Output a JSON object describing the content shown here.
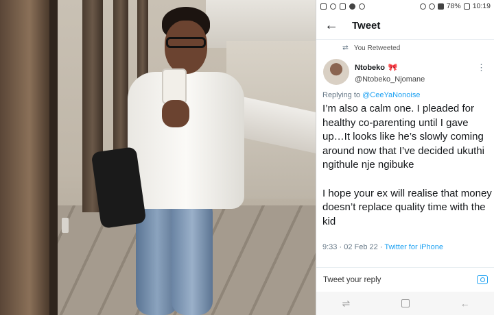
{
  "status_bar": {
    "battery": "78%",
    "time": "10:19"
  },
  "header": {
    "title": "Tweet"
  },
  "tweet": {
    "retweet_label": "You Retweeted",
    "display_name": "Ntobeko",
    "handle": "@Ntobeko_Njomane",
    "reply_prefix": "Replying to",
    "reply_to": "@CeeYaNonoise",
    "text": "I’m also a calm one. I pleaded for healthy co-parenting until I gave up…It looks like he’s slowly coming around now that I’ve decided ukuthi ngithule nje ngibuke\n\nI hope your ex will realise that money doesn’t replace quality time with the kid",
    "time": "9:33",
    "date": "02 Feb 22",
    "separator": "·",
    "source": "Twitter for iPhone"
  },
  "reply_box": {
    "placeholder": "Tweet your reply"
  },
  "icons": {
    "back": "arrow-left-icon",
    "retweet": "retweet-icon",
    "more": "more-vertical-icon",
    "camera": "camera-icon",
    "ribbon": "ribbon-emoji"
  },
  "colors": {
    "link": "#1da1f2",
    "muted": "#657786",
    "ribbon": "#e0245e"
  }
}
